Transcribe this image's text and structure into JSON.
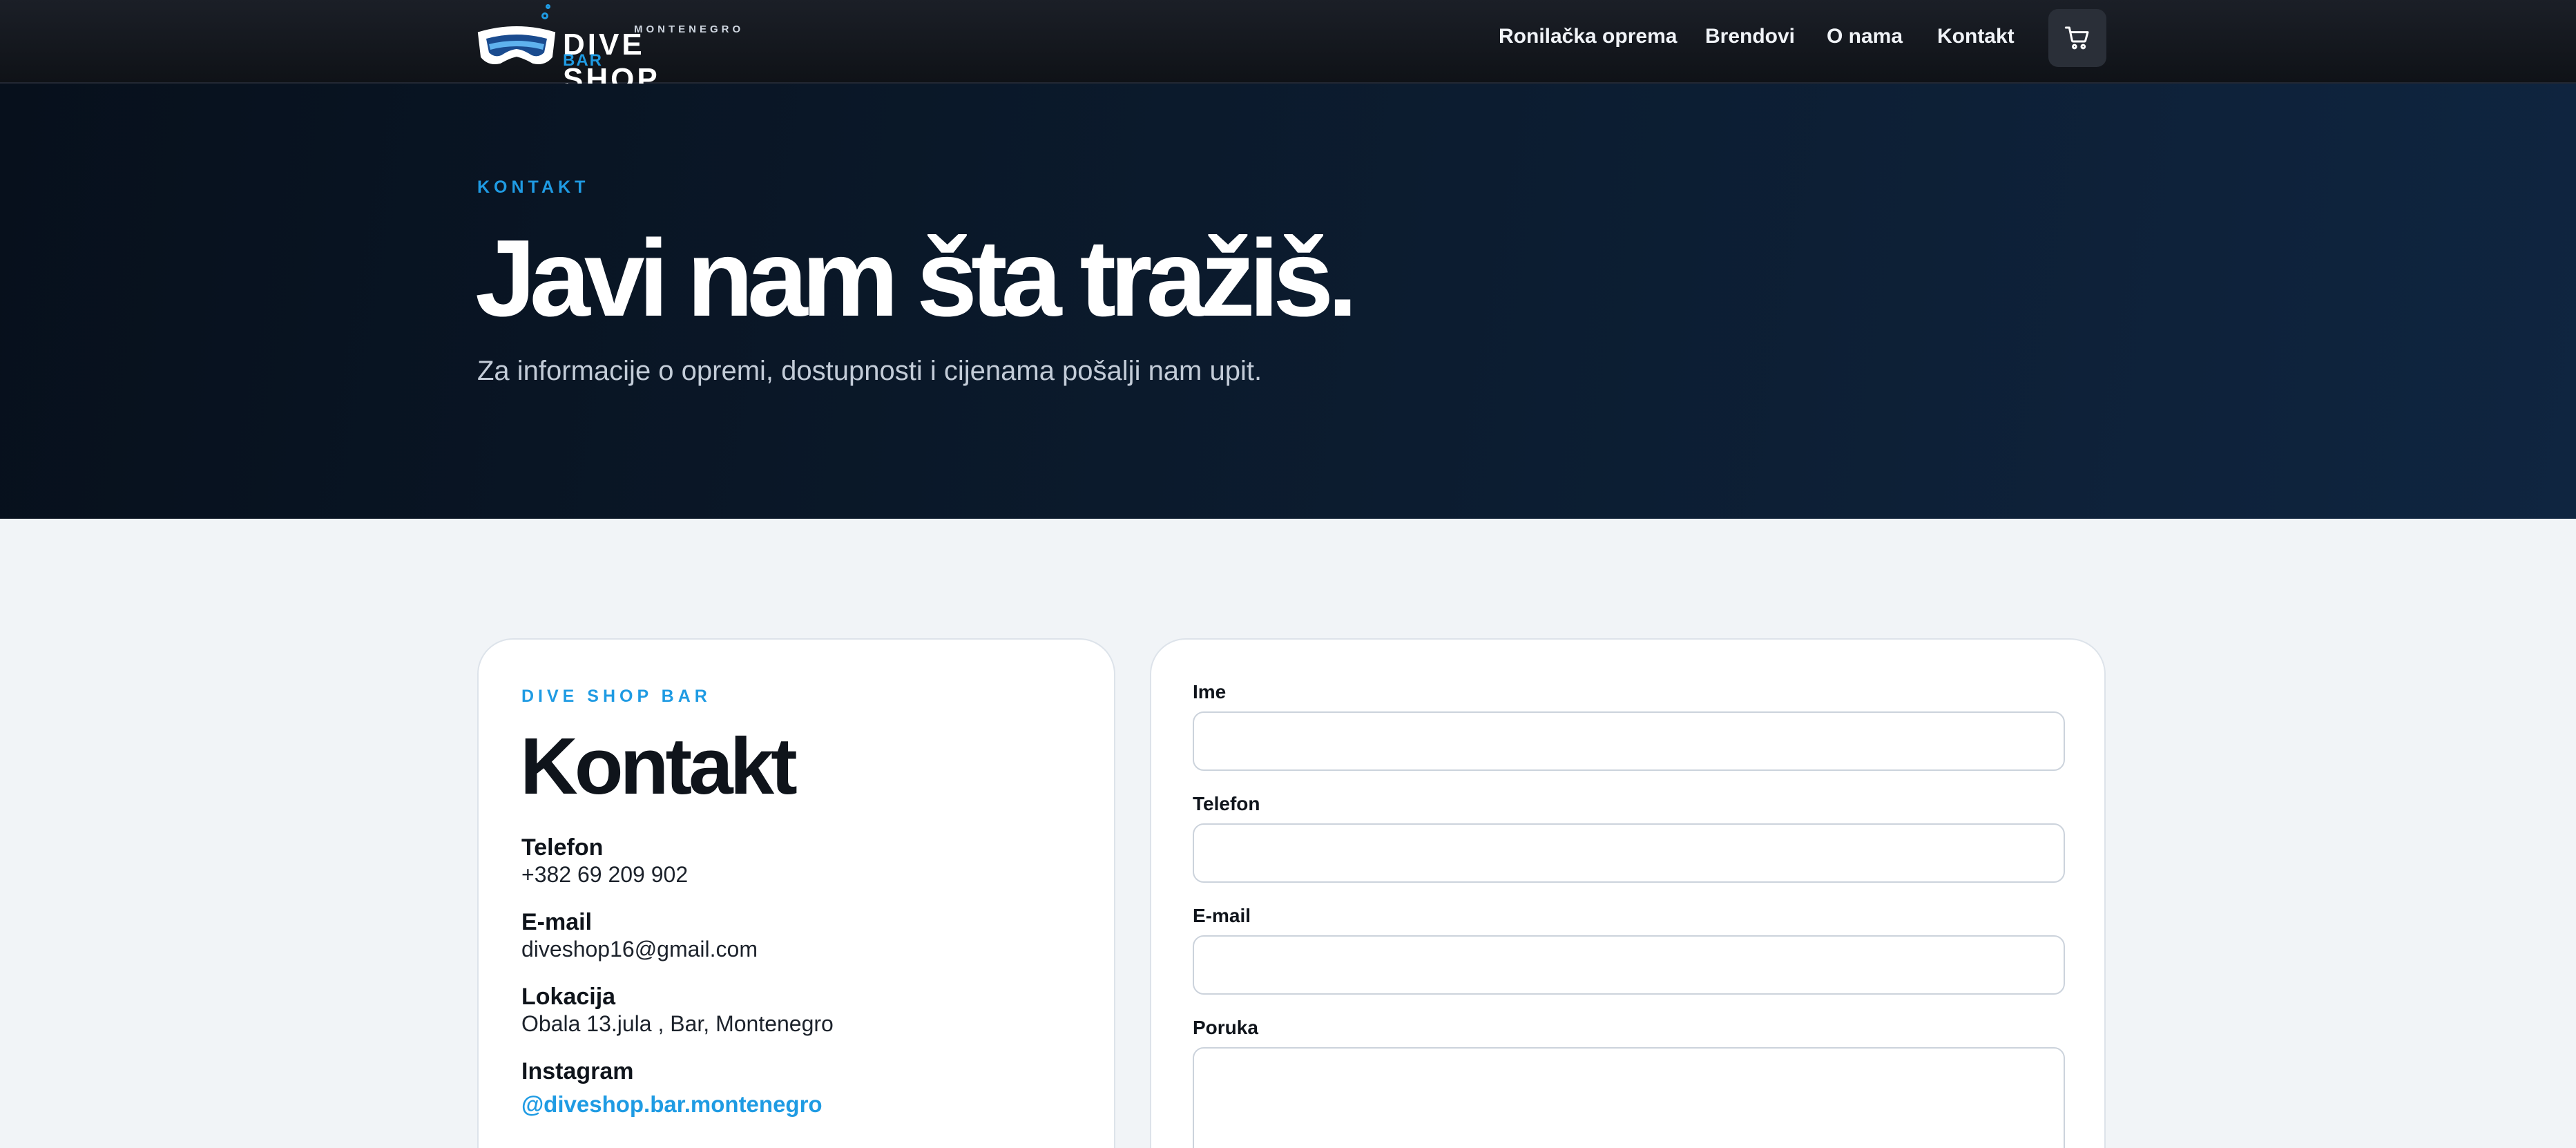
{
  "header": {
    "brand": {
      "small": "MONTENEGRO",
      "main": "DIVE SHOP",
      "sub": "BAR"
    },
    "nav": [
      {
        "label": "Ronilačka oprema"
      },
      {
        "label": "Brendovi"
      },
      {
        "label": "O nama"
      },
      {
        "label": "Kontakt"
      }
    ],
    "cart_icon": "shopping-cart-icon"
  },
  "hero": {
    "eyebrow": "KONTAKT",
    "title": "Javi nam šta tražiš.",
    "subtitle": "Za informacije o opremi, dostupnosti i cijenama pošalji nam upit."
  },
  "contact": {
    "eyebrow": "DIVE SHOP BAR",
    "title": "Kontakt",
    "phone_label": "Telefon",
    "phone_value": "+382 69 209 902",
    "email_label": "E-mail",
    "email_value": "diveshop16@gmail.com",
    "location_label": "Lokacija",
    "location_value": "Obala 13.jula , Bar, Montenegro",
    "instagram_label": "Instagram",
    "instagram_value": "@diveshop.bar.montenegro"
  },
  "form": {
    "name_label": "Ime",
    "name_value": "",
    "phone_label": "Telefon",
    "phone_value": "",
    "email_label": "E-mail",
    "email_value": "",
    "message_label": "Poruka",
    "message_value": ""
  },
  "colors": {
    "accent": "#1f9be3",
    "header_bg": "#14181f",
    "hero_bg": "#0b1a2c",
    "page_bg": "#f1f4f7"
  }
}
